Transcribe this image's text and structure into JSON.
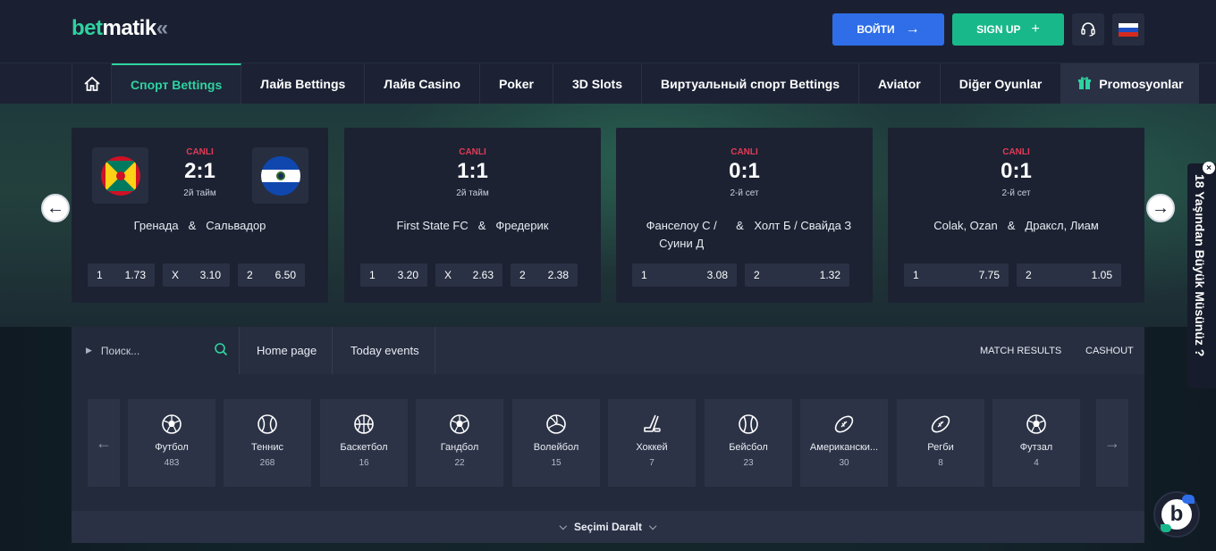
{
  "brand": {
    "logo_part1": "bet",
    "logo_part2": "matik",
    "logo_part3": "«"
  },
  "header": {
    "login_label": "ВОЙТИ",
    "signup_label": "SIGN UP",
    "colors": {
      "login": "#2f6ee8",
      "signup": "#19b88a",
      "accent": "#2fd3a0",
      "live": "#e23b56"
    }
  },
  "nav": {
    "items": [
      {
        "label": "Спорт Bettings",
        "active": true
      },
      {
        "label": "Лайв Bettings"
      },
      {
        "label": "Лайв Casino"
      },
      {
        "label": "Poker"
      },
      {
        "label": "3D Slots"
      },
      {
        "label": "Виртуальный спорт Bettings"
      },
      {
        "label": "Aviator"
      },
      {
        "label": "Diğer Oyunlar"
      }
    ],
    "promo_label": "Promosyonlar"
  },
  "matches": [
    {
      "status": "CANLI",
      "score": "2:1",
      "period": "2й тайм",
      "team1": "Гренада",
      "sep": "&",
      "team2": "Сальвадор",
      "odds": [
        {
          "k": "1",
          "v": "1.73"
        },
        {
          "k": "X",
          "v": "3.10"
        },
        {
          "k": "2",
          "v": "6.50"
        }
      ]
    },
    {
      "status": "CANLI",
      "score": "1:1",
      "period": "2й тайм",
      "team1": "First State FC",
      "sep": "&",
      "team2": "Фредерик",
      "odds": [
        {
          "k": "1",
          "v": "3.20"
        },
        {
          "k": "X",
          "v": "2.63"
        },
        {
          "k": "2",
          "v": "2.38"
        }
      ]
    },
    {
      "status": "CANLI",
      "score": "0:1",
      "period": "2-й сет",
      "team1": "Фанселоу С / Суини Д",
      "sep": "&",
      "team2": "Холт Б / Свайда З",
      "odds": [
        {
          "k": "1",
          "v": "3.08"
        },
        {
          "k": "2",
          "v": "1.32"
        }
      ]
    },
    {
      "status": "CANLI",
      "score": "0:1",
      "period": "2-й сет",
      "team1": "Colak, Ozan",
      "sep": "&",
      "team2": "Драксл, Лиам",
      "odds": [
        {
          "k": "1",
          "v": "7.75"
        },
        {
          "k": "2",
          "v": "1.05"
        }
      ]
    }
  ],
  "subbar": {
    "search_placeholder": "Поиск...",
    "tabs": [
      "Home page",
      "Today events"
    ],
    "right": [
      "MATCH RESULTS",
      "CASHOUT"
    ]
  },
  "sports": [
    {
      "name": "Футбол",
      "count": "483",
      "icon": "soccer-ball-icon"
    },
    {
      "name": "Теннис",
      "count": "268",
      "icon": "tennis-ball-icon"
    },
    {
      "name": "Баскетбол",
      "count": "16",
      "icon": "basketball-icon"
    },
    {
      "name": "Гандбол",
      "count": "22",
      "icon": "handball-icon"
    },
    {
      "name": "Волейбол",
      "count": "15",
      "icon": "volleyball-icon"
    },
    {
      "name": "Хоккей",
      "count": "7",
      "icon": "hockey-icon"
    },
    {
      "name": "Бейсбол",
      "count": "23",
      "icon": "baseball-icon"
    },
    {
      "name": "Американски...",
      "count": "30",
      "icon": "american-football-icon"
    },
    {
      "name": "Регби",
      "count": "8",
      "icon": "rugby-icon"
    },
    {
      "name": "Футзал",
      "count": "4",
      "icon": "futsal-icon"
    }
  ],
  "narrow_label": "Seçimi Daralt",
  "age_banner": "18 Yaşından Büyük Müsünüz ?"
}
